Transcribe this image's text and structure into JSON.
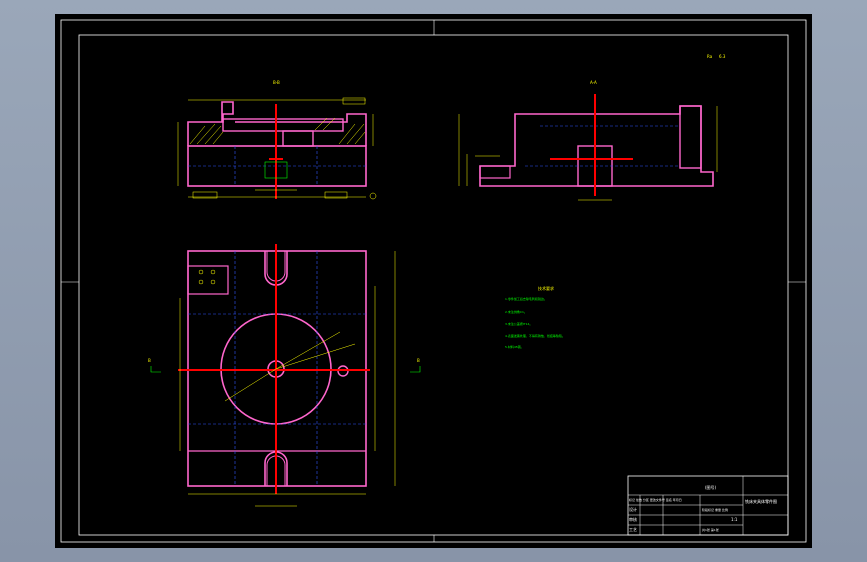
{
  "drawing": {
    "colors": {
      "background": "#000000",
      "frame": "#ffffff",
      "outline": "#ff66cc",
      "center": "#ff0000",
      "hidden": "#3355ff",
      "dimension": "#ffff00",
      "hatch": "#ffff00",
      "notes": "#00ff00"
    },
    "views": {
      "front_title": "B-B",
      "side_title": "A-A",
      "roughness_label": "Ra",
      "roughness_value": "6.3"
    },
    "section_marks": {
      "left": "B",
      "right": "B"
    },
    "notes": {
      "title": "技术要求",
      "lines": [
        "1.零件加工后去除毛刺和锐边。",
        "2.未注倒角C1。",
        "3.未注公差按IT14。",
        "4.表面发黑处理，不得有锈蚀、划痕等缺陷。",
        "5.材料45钢。"
      ]
    },
    "title_block": {
      "part_code": "(图号)",
      "part_name": "铣床夹具体零件图",
      "row1": "标记 处数 分区 更改文件号 签名 年月日",
      "row2": "设计",
      "row3": "审核",
      "row4": "工艺",
      "stage_row": "阶段标记 重量 比例",
      "scale": "1:1",
      "sheet_row": "共1张 第1张"
    }
  }
}
